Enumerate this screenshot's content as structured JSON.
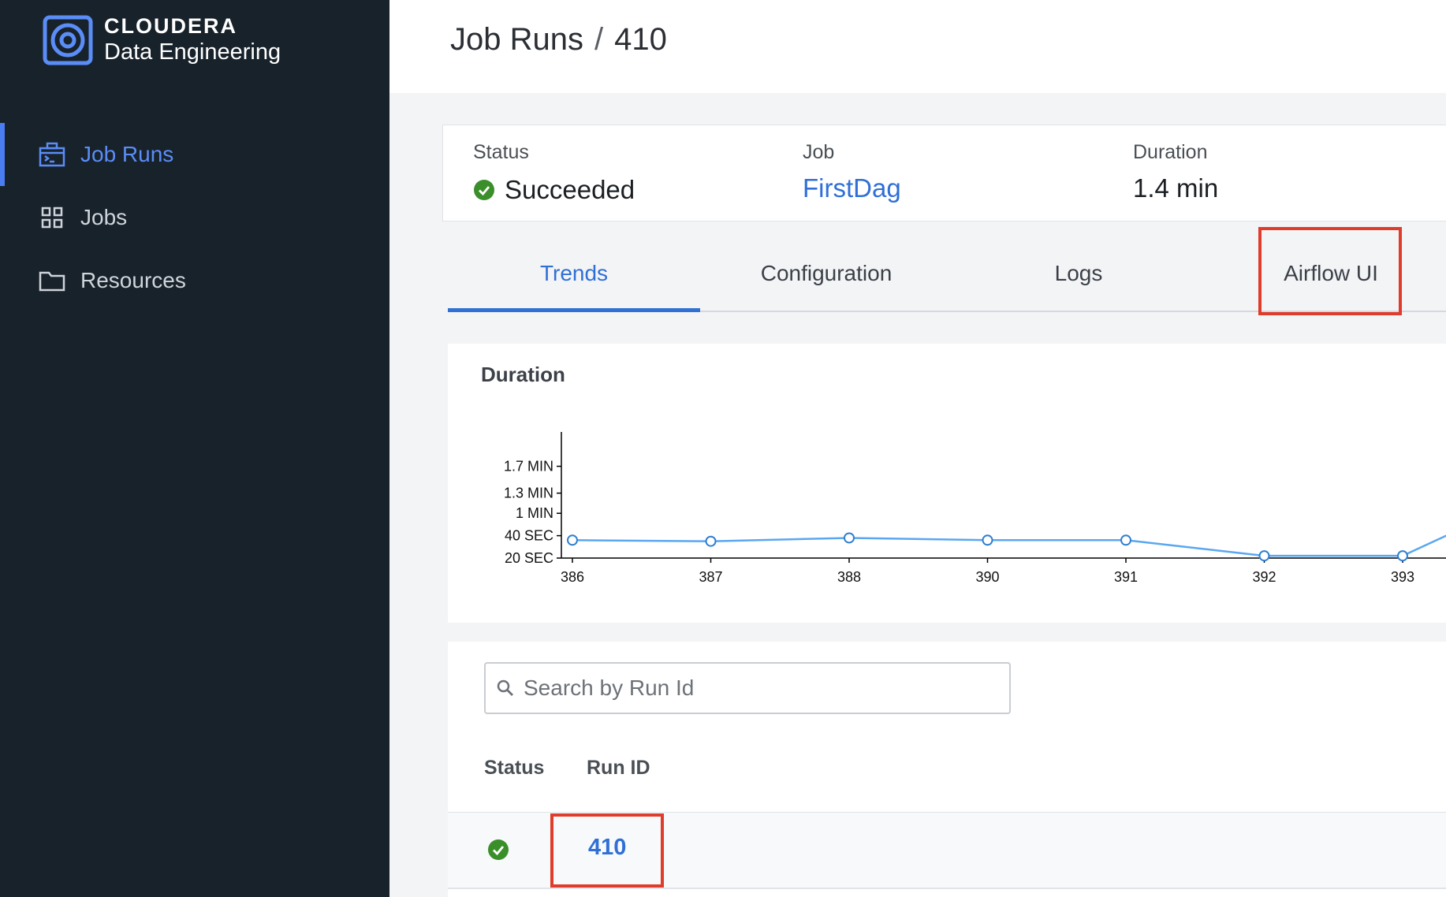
{
  "brand": {
    "name": "CLOUDERA",
    "product": "Data Engineering",
    "logo_icon": "cloudera-logo-icon"
  },
  "sidebar": {
    "items": [
      {
        "label": "Job Runs",
        "icon": "job-runs-icon",
        "active": true
      },
      {
        "label": "Jobs",
        "icon": "grid-icon",
        "active": false
      },
      {
        "label": "Resources",
        "icon": "folder-icon",
        "active": false
      }
    ]
  },
  "header": {
    "breadcrumb_parent": "Job Runs",
    "separator": "/",
    "breadcrumb_current": "410"
  },
  "summary": {
    "status_label": "Status",
    "status_value": "Succeeded",
    "job_label": "Job",
    "job_value": "FirstDag",
    "duration_label": "Duration",
    "duration_value": "1.4 min"
  },
  "tabs": [
    {
      "label": "Trends",
      "active": true
    },
    {
      "label": "Configuration",
      "active": false
    },
    {
      "label": "Logs",
      "active": false
    },
    {
      "label": "Airflow UI",
      "active": false,
      "highlighted": true
    }
  ],
  "chart_data": {
    "type": "line",
    "title": "Duration",
    "x": [
      "386",
      "387",
      "388",
      "390",
      "391",
      "392",
      "393"
    ],
    "y_seconds": [
      36,
      35,
      38,
      36,
      36,
      22,
      22
    ],
    "y_ticks": [
      {
        "label": "1.7 MIN",
        "seconds": 102
      },
      {
        "label": "1.3 MIN",
        "seconds": 78
      },
      {
        "label": "1 MIN",
        "seconds": 60
      },
      {
        "label": "40 SEC",
        "seconds": 40
      },
      {
        "label": "20 SEC",
        "seconds": 20
      }
    ],
    "ylim_seconds": [
      20,
      110
    ],
    "line_color": "#5aa7f0",
    "continues_beyond_view": true
  },
  "table": {
    "search_placeholder": "Search by Run Id",
    "columns": [
      "Status",
      "Run ID"
    ],
    "rows": [
      {
        "status": "succeeded",
        "run_id": "410",
        "highlighted": true
      }
    ]
  },
  "colors": {
    "accent": "#2f6fd6",
    "success": "#3b8f2a",
    "highlight": "#e03c2c",
    "sidebar_bg": "#18222b"
  }
}
